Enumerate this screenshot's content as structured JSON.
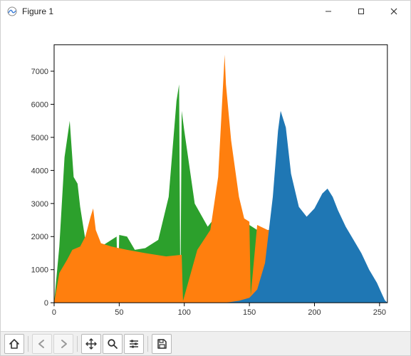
{
  "window": {
    "title": "Figure 1"
  },
  "toolbar": {
    "home": "Home",
    "back": "Back",
    "forward": "Forward",
    "pan": "Pan",
    "zoom": "Zoom",
    "configure": "Configure subplots",
    "save": "Save"
  },
  "chart_data": {
    "type": "area",
    "title": "",
    "xlabel": "",
    "ylabel": "",
    "xlim": [
      0,
      256
    ],
    "ylim": [
      0,
      7800
    ],
    "xticks": [
      0,
      50,
      100,
      150,
      200,
      250
    ],
    "yticks": [
      0,
      1000,
      2000,
      3000,
      4000,
      5000,
      6000,
      7000
    ],
    "series": [
      {
        "name": "green",
        "color": "#2ca02c",
        "x": [
          0,
          4,
          8,
          12,
          15,
          18,
          20,
          24,
          30,
          36,
          40,
          48,
          49,
          50,
          56,
          62,
          70,
          80,
          88,
          94,
          96,
          97,
          98,
          100,
          108,
          118,
          126,
          132,
          138,
          146,
          150,
          158,
          166,
          174,
          180,
          188,
          196,
          204,
          212,
          220,
          228,
          236,
          244,
          250,
          256
        ],
        "values": [
          0,
          1700,
          4400,
          5500,
          3800,
          3600,
          2900,
          1900,
          1700,
          1700,
          1800,
          2000,
          60,
          2050,
          2000,
          1600,
          1650,
          1900,
          3200,
          6100,
          6600,
          150,
          5800,
          5200,
          3000,
          2300,
          2700,
          2900,
          2400,
          2350,
          2350,
          2150,
          1900,
          1600,
          1200,
          800,
          520,
          360,
          220,
          140,
          80,
          40,
          0,
          0,
          0
        ]
      },
      {
        "name": "orange",
        "color": "#ff7f0e",
        "x": [
          0,
          4,
          10,
          14,
          20,
          24,
          28,
          30,
          32,
          36,
          44,
          56,
          70,
          86,
          98,
          99,
          110,
          120,
          126,
          131,
          132,
          136,
          142,
          146,
          150,
          151,
          156,
          164,
          172,
          178,
          184,
          190,
          196,
          200,
          206,
          212,
          218,
          224,
          230,
          236,
          242,
          248,
          252,
          256
        ],
        "values": [
          0,
          900,
          1300,
          1600,
          1700,
          2000,
          2600,
          2850,
          2200,
          1800,
          1700,
          1600,
          1500,
          1400,
          1450,
          50,
          1600,
          2200,
          3800,
          7500,
          6600,
          4900,
          3200,
          2550,
          2450,
          200,
          2350,
          2200,
          2200,
          2300,
          2250,
          2100,
          2000,
          1900,
          1500,
          900,
          600,
          380,
          220,
          120,
          60,
          20,
          0,
          0
        ]
      },
      {
        "name": "blue",
        "color": "#1f77b4",
        "x": [
          0,
          40,
          70,
          100,
          120,
          132,
          142,
          150,
          156,
          162,
          168,
          172,
          174,
          178,
          182,
          188,
          194,
          200,
          206,
          210,
          214,
          218,
          224,
          230,
          236,
          242,
          248,
          252,
          254,
          256
        ],
        "values": [
          0,
          0,
          0,
          0,
          0,
          0,
          60,
          150,
          400,
          1200,
          3200,
          5200,
          5800,
          5300,
          3900,
          2900,
          2600,
          2850,
          3300,
          3450,
          3200,
          2800,
          2300,
          1900,
          1500,
          1000,
          600,
          250,
          80,
          0
        ]
      }
    ]
  }
}
